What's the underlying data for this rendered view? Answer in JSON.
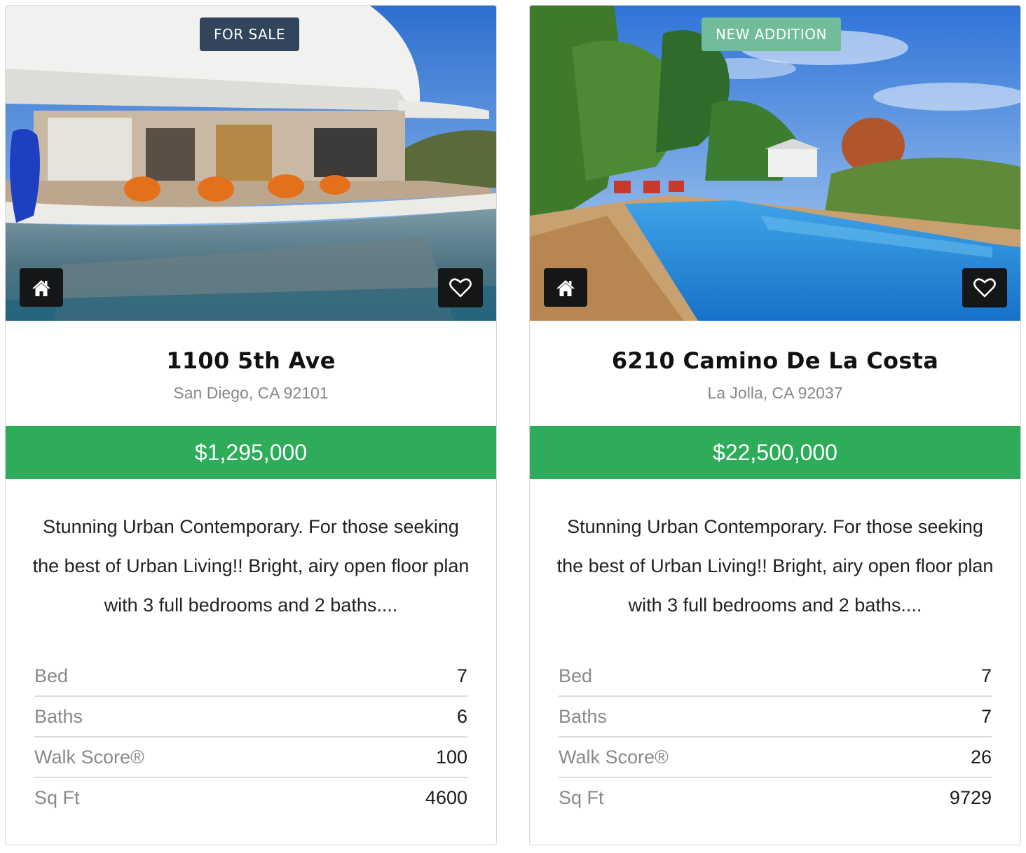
{
  "listings": [
    {
      "badge": "FOR SALE",
      "badge_color": "#33455c",
      "title": "1100 5th Ave",
      "address": "San Diego, CA 92101",
      "price": "$1,295,000",
      "description": "Stunning Urban Contemporary. For those seeking the best of Urban Living!! Bright, airy open floor plan with 3 full bedrooms and 2 baths....",
      "stats": [
        {
          "label": "Bed",
          "value": "7"
        },
        {
          "label": "Baths",
          "value": "6"
        },
        {
          "label": "Walk Score®",
          "value": "100"
        },
        {
          "label": "Sq Ft",
          "value": "4600"
        }
      ]
    },
    {
      "badge": "NEW ADDITION",
      "badge_color": "#71bd9a",
      "title": "6210 Camino De La Costa",
      "address": "La Jolla, CA 92037",
      "price": "$22,500,000",
      "description": "Stunning Urban Contemporary. For those seeking the best of Urban Living!! Bright, airy open floor plan with 3 full bedrooms and 2 baths....",
      "stats": [
        {
          "label": "Bed",
          "value": "7"
        },
        {
          "label": "Baths",
          "value": "7"
        },
        {
          "label": "Walk Score®",
          "value": "26"
        },
        {
          "label": "Sq Ft",
          "value": "9729"
        }
      ]
    }
  ],
  "colors": {
    "price_bar": "#2eac5a",
    "icon_button": "#141618"
  },
  "icons": {
    "home": "home-icon",
    "favorite": "heart-outline-icon"
  }
}
